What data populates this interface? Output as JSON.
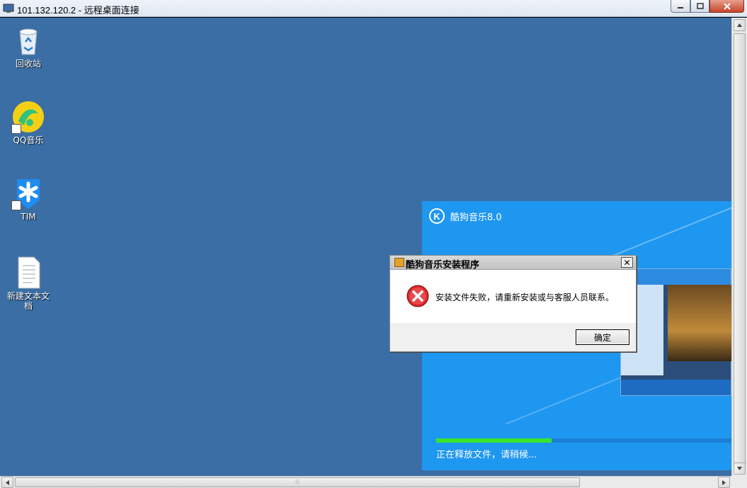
{
  "window": {
    "title": "101.132.120.2 - 远程桌面连接",
    "controls": {
      "minimize": "minimize-icon",
      "maximize": "maximize-icon",
      "close": "close-icon"
    }
  },
  "desktop": {
    "background": "#3a6ea5",
    "icons": [
      {
        "label": "回收站",
        "icon": "recycle-bin-icon"
      },
      {
        "label": "QQ音乐",
        "icon": "qq-music-icon"
      },
      {
        "label": "TIM",
        "icon": "tim-icon"
      },
      {
        "label": "新建文本文档",
        "icon": "text-document-icon"
      }
    ]
  },
  "installer": {
    "logo_letter": "K",
    "title": "酷狗音乐8.0",
    "progress": 0.39,
    "progress_color": "#37e52e",
    "status": "正在释放文件，请稍候..."
  },
  "dialog": {
    "title": "酷狗音乐安装程序",
    "close_glyph": "✕",
    "message": "安装文件失败，请重新安装或与客服人员联系。",
    "icon": "error-icon",
    "ok_label": "确定"
  },
  "scrollbar": {
    "grip": "⦙⦙⦙"
  }
}
